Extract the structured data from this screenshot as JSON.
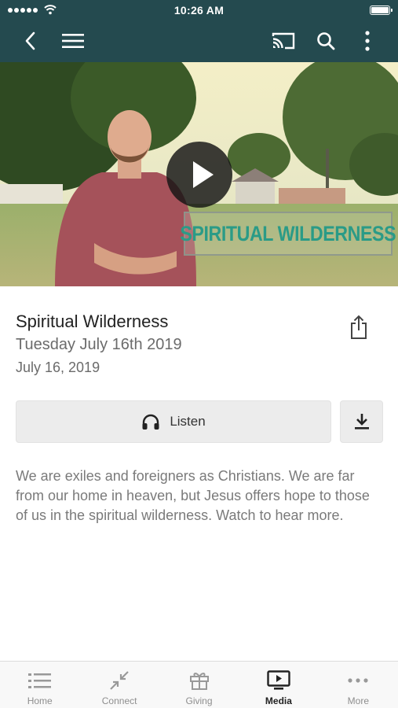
{
  "status_bar": {
    "time": "10:26 AM"
  },
  "nav": {
    "back_icon": "chevron-left-icon",
    "menu_icon": "hamburger-menu-icon",
    "cast_icon": "cast-icon",
    "search_icon": "search-icon",
    "more_icon": "vertical-dots-icon"
  },
  "video": {
    "overlay_text": "SPIRITUAL WILDERNESS",
    "play_icon": "play-icon"
  },
  "details": {
    "title": "Spiritual Wilderness",
    "subtitle": "Tuesday July 16th 2019",
    "date": "July 16, 2019",
    "share_icon": "share-icon"
  },
  "actions": {
    "listen_label": "Listen",
    "listen_icon": "headphones-icon",
    "download_icon": "download-icon"
  },
  "description": "We are exiles and foreigners as Christians.  We are far from our home in heaven, but Jesus offers hope to those of us in the spiritual wilderness.  Watch to hear more.",
  "tabbar": {
    "active": "Media",
    "tabs": [
      {
        "label": "Home",
        "icon": "list-icon"
      },
      {
        "label": "Connect",
        "icon": "connect-arrows-icon"
      },
      {
        "label": "Giving",
        "icon": "gift-icon"
      },
      {
        "label": "Media",
        "icon": "tv-play-icon"
      },
      {
        "label": "More",
        "icon": "horizontal-dots-icon"
      }
    ]
  },
  "colors": {
    "header": "#244a4f",
    "overlay_text": "#2a9b87",
    "muted_text": "#7a7a7a"
  }
}
